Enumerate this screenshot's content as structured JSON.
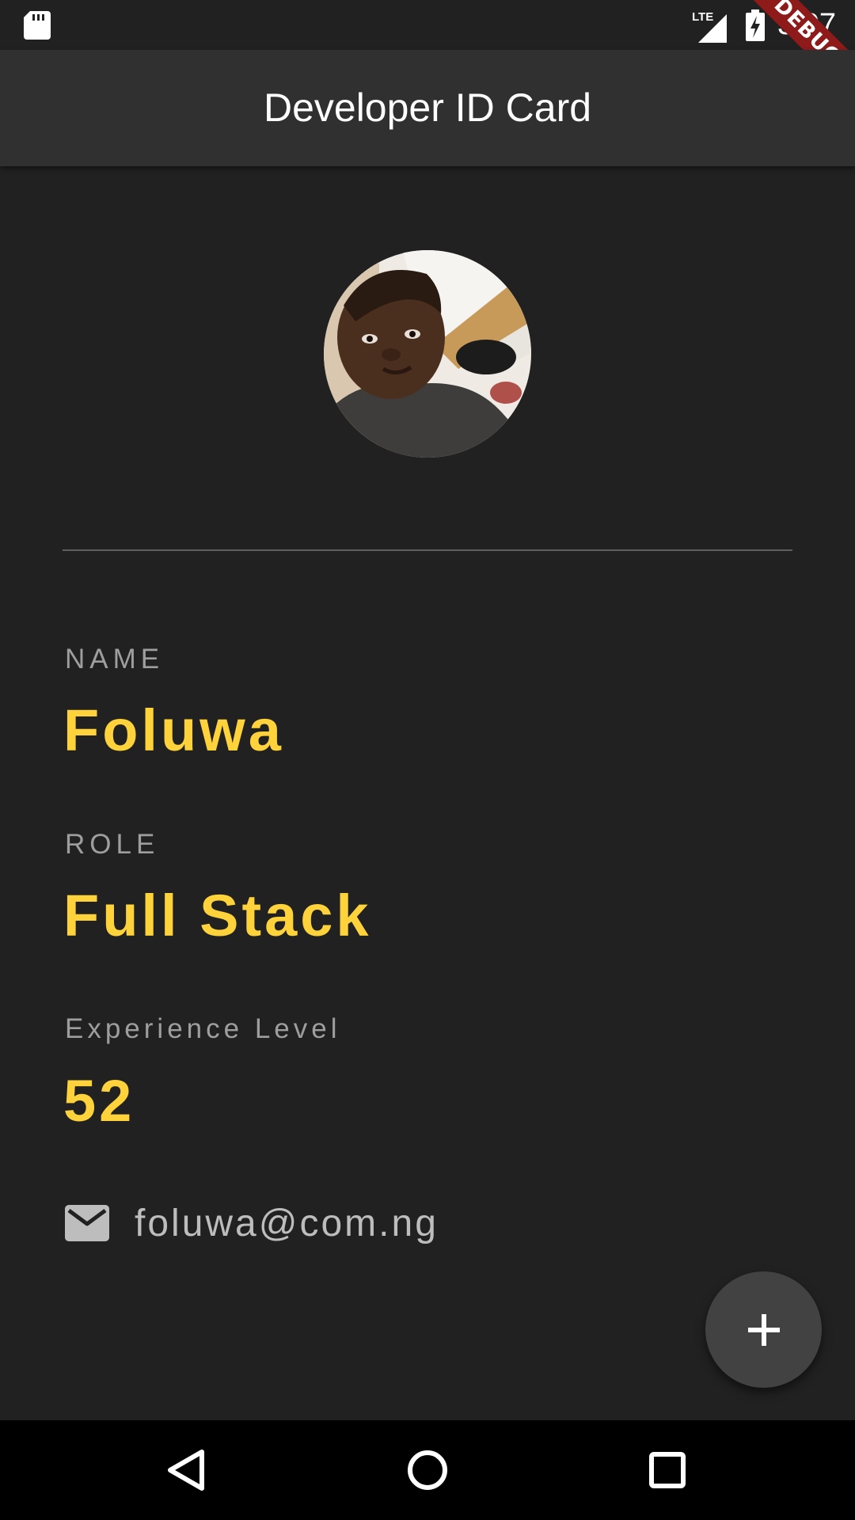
{
  "status_bar": {
    "time": "3:07",
    "network": "LTE",
    "debug_banner": "DEBUG"
  },
  "app_bar": {
    "title": "Developer ID Card"
  },
  "profile": {
    "avatar_alt": "profile photo",
    "name_label": "NAME",
    "name_value": "Foluwa",
    "role_label": "ROLE",
    "role_value": "Full Stack",
    "experience_label": "Experience Level",
    "experience_value": "52",
    "email": "foluwa@com.ng"
  },
  "icons": {
    "email": "mail-icon",
    "fab": "plus-icon",
    "nav_back": "back-triangle-icon",
    "nav_home": "home-circle-icon",
    "nav_recents": "recents-square-icon"
  },
  "colors": {
    "background": "#212121",
    "app_bar": "#303030",
    "accent": "#fdd23b",
    "label": "#9e9e9e",
    "fab": "#424242",
    "debug": "#8e1a1a"
  }
}
